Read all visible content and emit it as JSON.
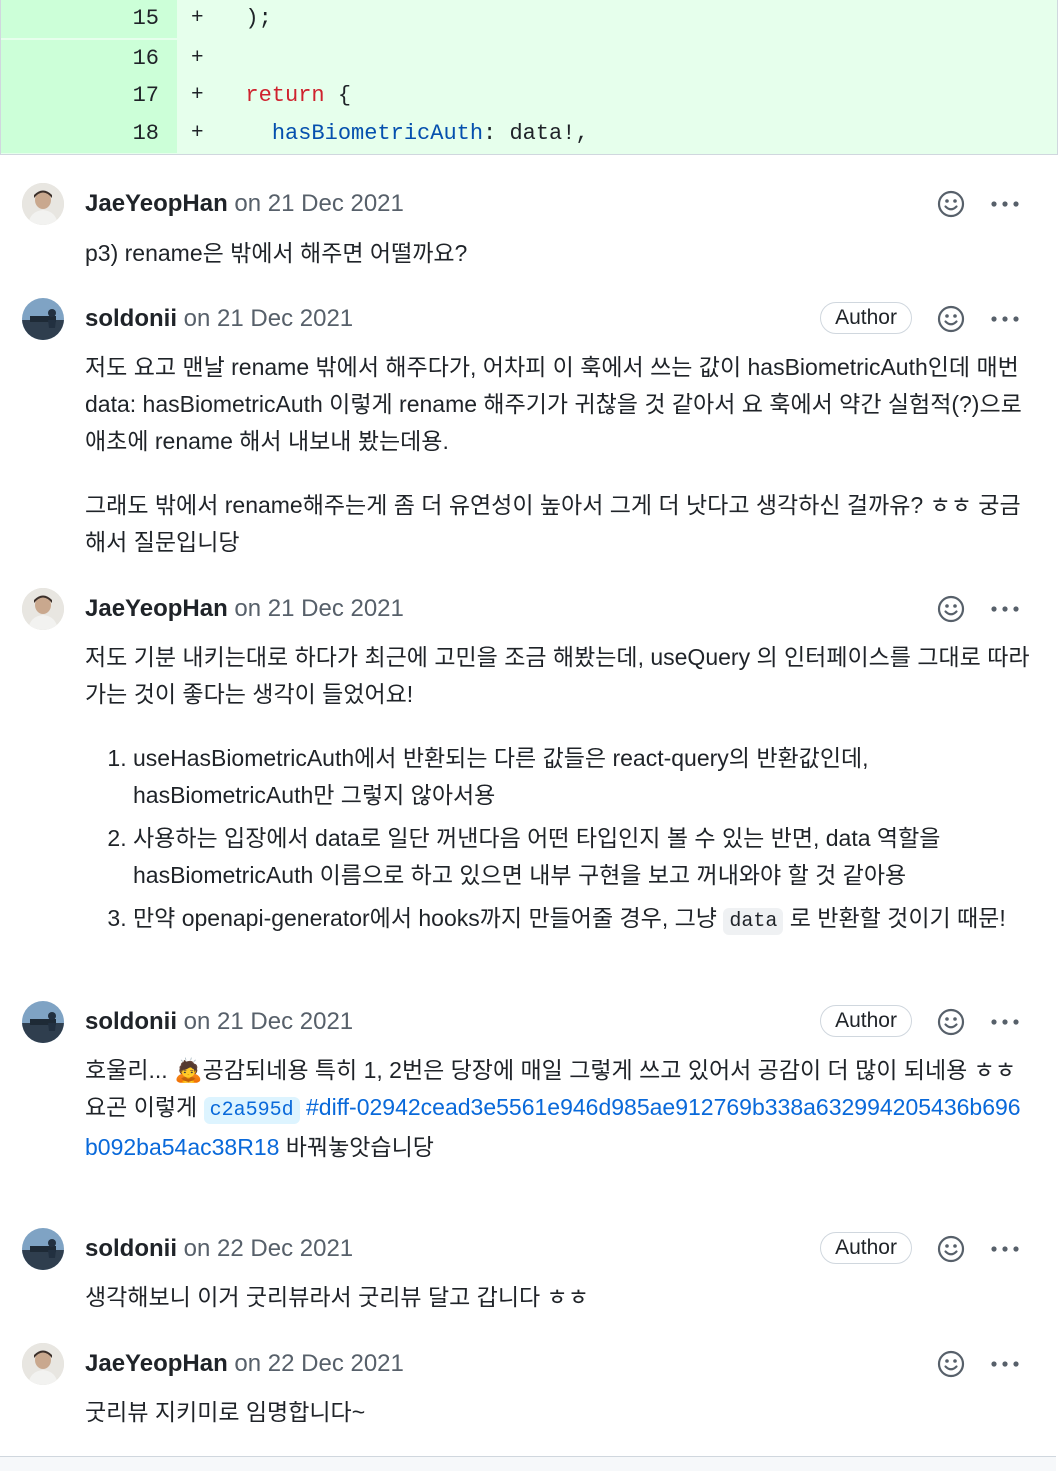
{
  "diff": {
    "lines": [
      {
        "num": "15",
        "sign": "+",
        "code": "  );"
      },
      {
        "num": "16",
        "sign": "+",
        "code": ""
      },
      {
        "num": "17",
        "sign": "+",
        "keyword": "return",
        "rest": " {"
      },
      {
        "num": "18",
        "sign": "+",
        "prop": "hasBiometricAuth",
        "rest": ": data!,"
      }
    ]
  },
  "comments": [
    {
      "author": "JaeYeopHan",
      "date": "on 21 Dec 2021",
      "body": "p3) rename은 밖에서 해주면 어떨까요?"
    },
    {
      "author": "soldonii",
      "date": "on 21 Dec 2021",
      "badge": "Author",
      "body_p1": "저도 요고 맨날 rename 밖에서 해주다가, 어차피 이 훅에서 쓰는 값이 hasBiometricAuth인데 매번 data: hasBiometricAuth 이렇게 rename 해주기가 귀찮을 것 같아서 요 훅에서 약간 실험적(?)으로 애초에 rename 해서 내보내 봤는데용.",
      "body_p2": "그래도 밖에서 rename해주는게 좀 더 유연성이 높아서 그게 더 낫다고 생각하신 걸까유? ㅎㅎ 궁금해서 질문입니당"
    },
    {
      "author": "JaeYeopHan",
      "date": "on 21 Dec 2021",
      "body_p1": "저도 기분 내키는대로 하다가 최근에 고민을 조금 해봤는데, useQuery 의 인터페이스를 그대로 따라가는 것이 좋다는 생각이 들었어요!",
      "list": [
        "useHasBiometricAuth에서 반환되는 다른 값들은 react-query의 반환값인데, hasBiometricAuth만 그렇지 않아서용",
        "사용하는 입장에서 data로 일단 꺼낸다음 어떤 타입인지 볼 수 있는 반면, data 역할을 hasBiometricAuth 이름으로 하고 있으면 내부 구현을 보고 꺼내와야 할 것 같아용"
      ],
      "list3_pre": "만약 openapi-generator에서 hooks까지 만들어줄 경우, 그냥 ",
      "list3_code": "data",
      "list3_post": " 로 반환할 것이기 때문!"
    },
    {
      "author": "soldonii",
      "date": "on 21 Dec 2021",
      "badge": "Author",
      "body_pre": "호울리... 🙇공감되네용 특히 1, 2번은 당장에 매일 그렇게 쓰고 있어서 공감이 더 많이 되네용 ㅎㅎ 요곤 이렇게 ",
      "commit": "c2a595d",
      "anchor": "#diff-02942cead3e5561e946d985ae912769b338a632994205436b696b092ba54ac38R18",
      "body_post": " 바꿔놓앗습니당"
    },
    {
      "author": "soldonii",
      "date": "on 22 Dec 2021",
      "badge": "Author",
      "body": "생각해보니 이거 굿리뷰라서 굿리뷰 달고 갑니다 ㅎㅎ"
    },
    {
      "author": "JaeYeopHan",
      "date": "on 22 Dec 2021",
      "body": "굿리뷰 지키미로 임명합니다~"
    }
  ],
  "icons": {
    "reaction": "smiley-icon",
    "more": "kebab-horizontal-icon",
    "avatar_jae": "avatar-photo",
    "avatar_sol": "avatar-photo"
  },
  "colors": {
    "diff_bg": "#e6ffec",
    "diff_num_bg": "#ccffd8",
    "link": "#0969da",
    "keyword": "#cf222e",
    "prop": "#0550ae"
  }
}
